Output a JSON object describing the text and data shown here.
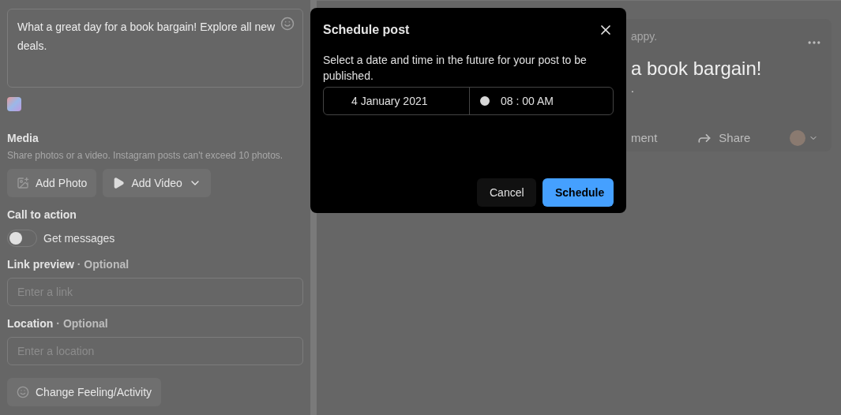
{
  "composer": {
    "text": "What a great day for a book bargain! Explore all new deals."
  },
  "media": {
    "title": "Media",
    "hint": "Share photos or a video. Instagram posts can't exceed 10 photos.",
    "buttons": [
      {
        "label": "Add Photo",
        "kind": "photo"
      },
      {
        "label": "Add Video",
        "kind": "video"
      }
    ]
  },
  "call_to_action": {
    "title": "Call to action",
    "label": "Get messages",
    "on": false
  },
  "link_preview": {
    "title": "Link preview",
    "optional": "· Optional",
    "placeholder": "Enter a link"
  },
  "location": {
    "title": "Location",
    "optional": "· Optional",
    "placeholder": "Enter a location"
  },
  "feeling_button": "Change Feeling/Activity",
  "preview": {
    "status": "appy.",
    "headline": "a book bargain!",
    "second_line": ".",
    "actions": [
      {
        "label": "ment",
        "kind": "comment"
      },
      {
        "label": "Share",
        "kind": "share"
      }
    ]
  },
  "dialog": {
    "title": "Schedule post",
    "description": "Select a date and time in the future for your post to be published.",
    "date": "4 January 2021",
    "time": "08 : 00 AM",
    "buttons": [
      {
        "label": "Cancel",
        "kind": "secondary"
      },
      {
        "label": "Schedule",
        "kind": "primary"
      }
    ]
  }
}
